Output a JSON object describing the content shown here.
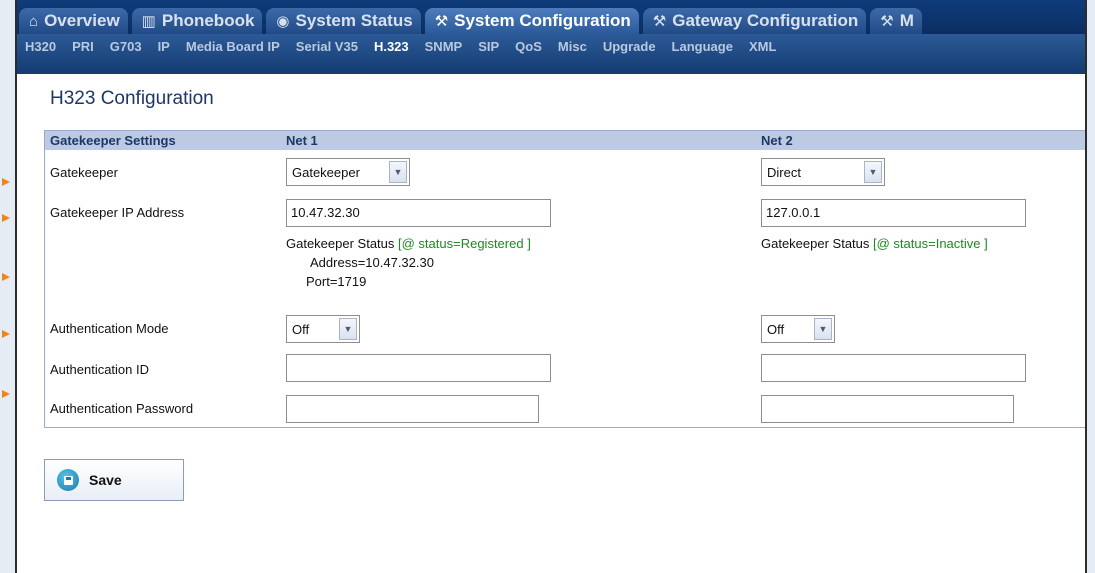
{
  "tabs": [
    {
      "label": "Overview",
      "icon": "home-icon",
      "glyph": "⌂",
      "active": false
    },
    {
      "label": "Phonebook",
      "icon": "phonebook-icon",
      "glyph": "▥",
      "active": false
    },
    {
      "label": "System Status",
      "icon": "status-icon",
      "glyph": "◉",
      "active": false
    },
    {
      "label": "System Configuration",
      "icon": "wrench-icon",
      "glyph": "⚒",
      "active": true
    },
    {
      "label": "Gateway Configuration",
      "icon": "wrench-icon",
      "glyph": "⚒",
      "active": false
    },
    {
      "label": "M",
      "icon": "wrench-icon",
      "glyph": "⚒",
      "active": false
    }
  ],
  "subnav": [
    "H320",
    "PRI",
    "G703",
    "IP",
    "Media Board IP",
    "Serial V35",
    "H.323",
    "SNMP",
    "SIP",
    "QoS",
    "Misc",
    "Upgrade",
    "Language",
    "XML"
  ],
  "subnav_active": "H.323",
  "page_title": "H323 Configuration",
  "section": {
    "title": "Gatekeeper Settings",
    "net1": "Net 1",
    "net2": "Net 2"
  },
  "fields": {
    "gatekeeper": {
      "label": "Gatekeeper",
      "net1": "Gatekeeper",
      "net2": "Direct"
    },
    "gatekeeper_ip": {
      "label": "Gatekeeper IP Address",
      "net1": "10.47.32.30",
      "net2": "127.0.0.1"
    },
    "status": {
      "net1_prefix": "Gatekeeper Status ",
      "net1_value": "[@ status=Registered ]",
      "net1_address": "Address=10.47.32.30",
      "net1_port": "Port=1719",
      "net2_prefix": "Gatekeeper Status ",
      "net2_value": "[@ status=Inactive ]"
    },
    "auth_mode": {
      "label": "Authentication Mode",
      "net1": "Off",
      "net2": "Off"
    },
    "auth_id": {
      "label": "Authentication ID",
      "net1": "",
      "net2": ""
    },
    "auth_password": {
      "label": "Authentication Password",
      "net1": "",
      "net2": ""
    }
  },
  "save_label": "Save",
  "colors": {
    "arrow": "#f0861a",
    "status_green": "#1f8a1f",
    "header_bg": "#bccbe3",
    "nav_bg": "#0f3c7a"
  }
}
